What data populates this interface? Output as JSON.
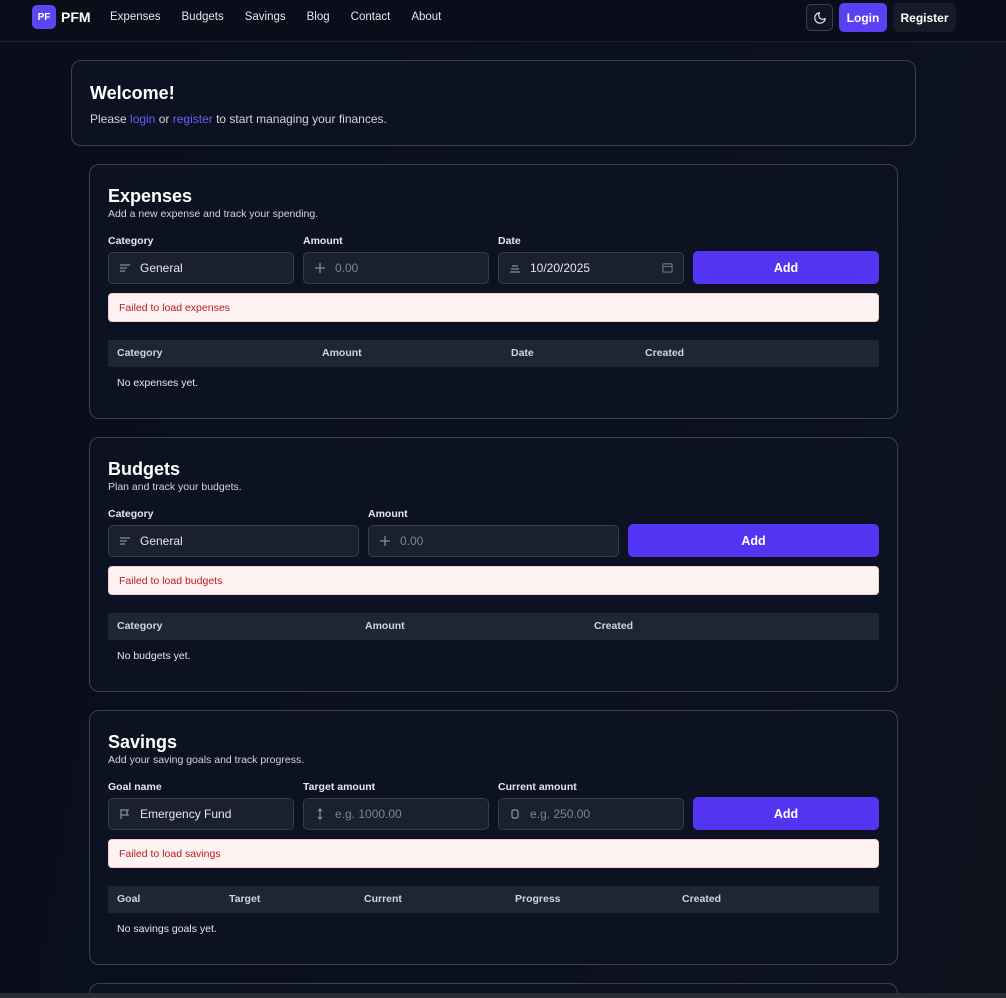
{
  "nav": {
    "logo_badge": "PF",
    "logo_text": "PFM",
    "links": [
      "Expenses",
      "Budgets",
      "Savings",
      "Blog",
      "Contact",
      "About"
    ],
    "theme_icon": "moon-icon",
    "login": "Login",
    "register": "Register"
  },
  "welcome": {
    "title": "Welcome!",
    "pre": "Please ",
    "login_link": "login",
    "mid": " or ",
    "register_link": "register",
    "post": " to start managing your finances."
  },
  "expenses": {
    "title": "Expenses",
    "subtitle": "Add a new expense and track your spending.",
    "category_label": "Category",
    "category_value": "General",
    "amount_label": "Amount",
    "amount_placeholder": "0.00",
    "date_label": "Date",
    "date_value": "10/20/2025",
    "add": "Add",
    "error": "Failed to load expenses",
    "columns": [
      "Category",
      "Amount",
      "Date",
      "Created"
    ],
    "empty": "No expenses yet."
  },
  "budgets": {
    "title": "Budgets",
    "subtitle": "Plan and track your budgets.",
    "category_label": "Category",
    "category_value": "General",
    "amount_label": "Amount",
    "amount_placeholder": "0.00",
    "add": "Add",
    "error": "Failed to load budgets",
    "columns": [
      "Category",
      "Amount",
      "Created"
    ],
    "empty": "No budgets yet."
  },
  "savings": {
    "title": "Savings",
    "subtitle": "Add your saving goals and track progress.",
    "goal_label": "Goal name",
    "goal_value": "Emergency Fund",
    "target_label": "Target amount",
    "target_placeholder": "e.g. 1000.00",
    "current_label": "Current amount",
    "current_placeholder": "e.g. 250.00",
    "add": "Add",
    "error": "Failed to load savings",
    "columns": [
      "Goal",
      "Target",
      "Current",
      "Progress",
      "Created"
    ],
    "empty": "No savings goals yet."
  },
  "colors": {
    "accent": "#5234f2",
    "background": "#0b1020",
    "card": "#0d1222",
    "error_bg": "#fef2f2",
    "error_text": "#b91c1c"
  }
}
